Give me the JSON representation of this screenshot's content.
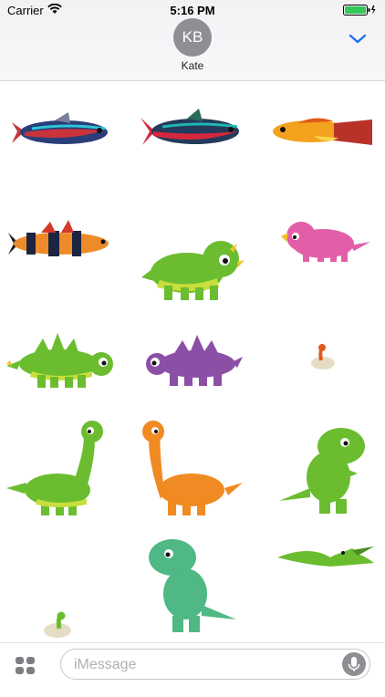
{
  "status_bar": {
    "carrier": "Carrier",
    "time": "5:16 PM"
  },
  "header": {
    "avatar_initials": "KB",
    "contact_name": "Kate",
    "collapse_icon": "chevron-down-icon",
    "accent_color": "#1a73e8"
  },
  "stickers": [
    {
      "name": "neon-tetra-fish-sticker"
    },
    {
      "name": "cardinal-tetra-fish-sticker"
    },
    {
      "name": "orange-molly-fish-sticker"
    },
    {
      "name": "clown-loach-fish-sticker"
    },
    {
      "name": "green-triceratops-sticker"
    },
    {
      "name": "pink-triceratops-sticker"
    },
    {
      "name": "green-stegosaurus-sticker"
    },
    {
      "name": "purple-stegosaurus-sticker"
    },
    {
      "name": "hatchling-egg-sticker"
    },
    {
      "name": "green-brachiosaurus-sticker"
    },
    {
      "name": "orange-brachiosaurus-sticker"
    },
    {
      "name": "green-trex-sticker"
    },
    {
      "name": "teal-trex-sticker"
    },
    {
      "name": "green-pterodactyl-sticker"
    },
    {
      "name": "green-hatchling-egg-sticker"
    }
  ],
  "input_bar": {
    "placeholder": "iMessage",
    "apps_icon": "app-drawer-icon",
    "mic_icon": "microphone-icon"
  }
}
